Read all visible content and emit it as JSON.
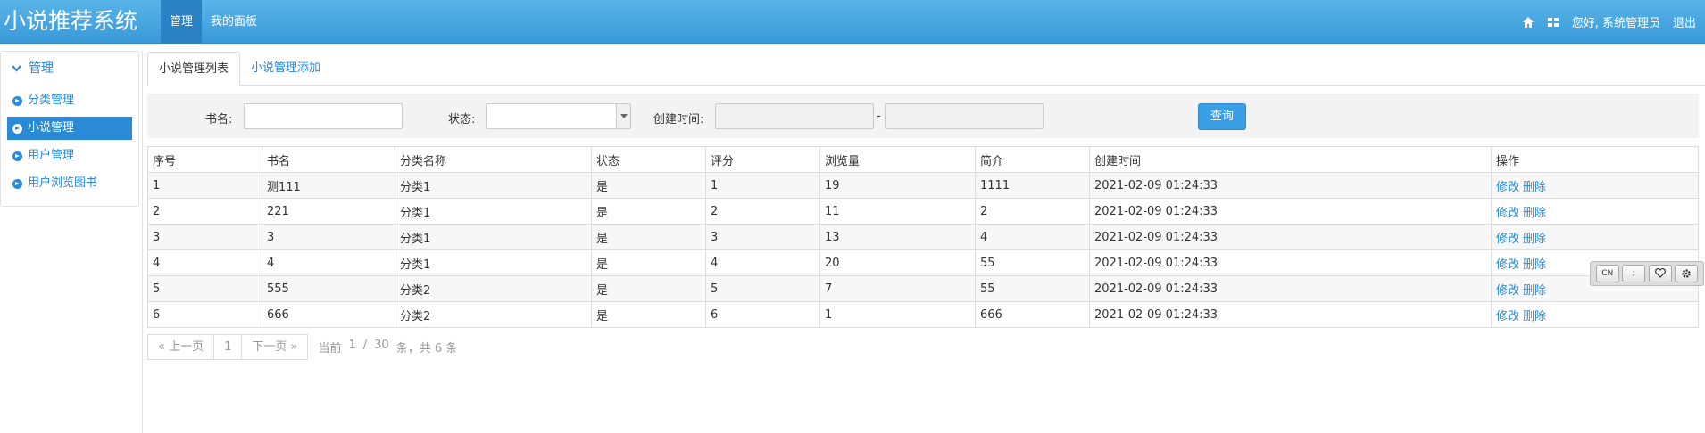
{
  "header": {
    "brand": "小说推荐系统",
    "nav": [
      {
        "label": "管理",
        "active": true
      },
      {
        "label": "我的面板",
        "active": false
      }
    ],
    "greeting": "您好, 系统管理员",
    "logout": "退出"
  },
  "sidebar": {
    "section": "管理",
    "items": [
      {
        "label": "分类管理",
        "active": false
      },
      {
        "label": "小说管理",
        "active": true
      },
      {
        "label": "用户管理",
        "active": false
      },
      {
        "label": "用户浏览图书",
        "active": false
      }
    ]
  },
  "tabs": [
    {
      "label": "小说管理列表",
      "active": true
    },
    {
      "label": "小说管理添加",
      "active": false
    }
  ],
  "filter": {
    "book_label": "书名:",
    "book_value": "",
    "status_label": "状态:",
    "status_value": "",
    "created_label": "创建时间:",
    "date_sep": "-",
    "date_from": "",
    "date_to": "",
    "search_btn": "查询"
  },
  "table": {
    "headers": [
      "序号",
      "书名",
      "分类名称",
      "状态",
      "评分",
      "浏览量",
      "简介",
      "创建时间",
      "操作"
    ],
    "rows": [
      [
        "1",
        "测111",
        "分类1",
        "是",
        "1",
        "19",
        "1111",
        "2021-02-09 01:24:33"
      ],
      [
        "2",
        "221",
        "分类1",
        "是",
        "2",
        "11",
        "2",
        "2021-02-09 01:24:33"
      ],
      [
        "3",
        "3",
        "分类1",
        "是",
        "3",
        "13",
        "4",
        "2021-02-09 01:24:33"
      ],
      [
        "4",
        "4",
        "分类1",
        "是",
        "4",
        "20",
        "55",
        "2021-02-09 01:24:33"
      ],
      [
        "5",
        "555",
        "分类2",
        "是",
        "5",
        "7",
        "55",
        "2021-02-09 01:24:33"
      ],
      [
        "6",
        "666",
        "分类2",
        "是",
        "6",
        "1",
        "666",
        "2021-02-09 01:24:33"
      ]
    ],
    "edit_label": "修改",
    "delete_label": "删除"
  },
  "pager": {
    "prev": "« 上一页",
    "page": "1",
    "next": "下一页 »",
    "current_label": "当前",
    "current": "1",
    "sep": "/",
    "total_pages": "30",
    "suffix": "条，共 6 条"
  },
  "floatbar": {
    "cn": "CN",
    "punct": ";"
  }
}
